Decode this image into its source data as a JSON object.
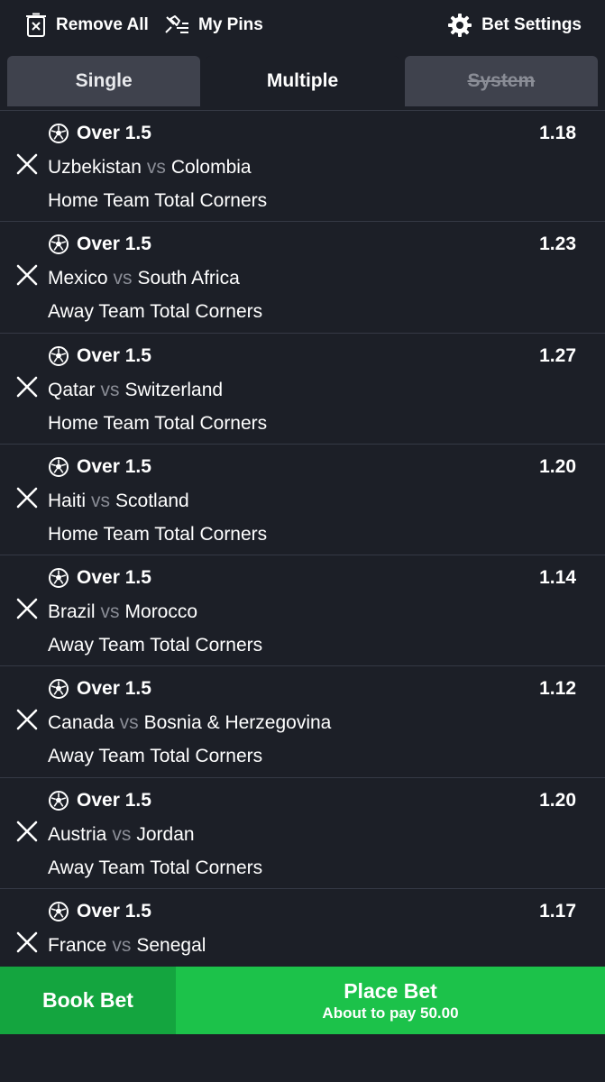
{
  "topbar": {
    "remove_all": "Remove All",
    "my_pins": "My Pins",
    "bet_settings": "Bet Settings"
  },
  "tabs": [
    {
      "label": "Single",
      "state": "inactive"
    },
    {
      "label": "Multiple",
      "state": "active"
    },
    {
      "label": "System",
      "state": "disabled"
    }
  ],
  "vs_label": "vs",
  "selections": [
    {
      "pick": "Over 1.5",
      "odds": "1.18",
      "home": "Uzbekistan",
      "away": "Colombia",
      "market": "Home Team Total Corners"
    },
    {
      "pick": "Over 1.5",
      "odds": "1.23",
      "home": "Mexico",
      "away": "South Africa",
      "market": "Away Team Total Corners"
    },
    {
      "pick": "Over 1.5",
      "odds": "1.27",
      "home": "Qatar",
      "away": "Switzerland",
      "market": "Home Team Total Corners"
    },
    {
      "pick": "Over 1.5",
      "odds": "1.20",
      "home": "Haiti",
      "away": "Scotland",
      "market": "Home Team Total Corners"
    },
    {
      "pick": "Over 1.5",
      "odds": "1.14",
      "home": "Brazil",
      "away": "Morocco",
      "market": "Away Team Total Corners"
    },
    {
      "pick": "Over 1.5",
      "odds": "1.12",
      "home": "Canada",
      "away": "Bosnia & Herzegovina",
      "market": "Away Team Total Corners"
    },
    {
      "pick": "Over 1.5",
      "odds": "1.20",
      "home": "Austria",
      "away": "Jordan",
      "market": "Away Team Total Corners"
    },
    {
      "pick": "Over 1.5",
      "odds": "1.17",
      "home": "France",
      "away": "Senegal",
      "market": ""
    }
  ],
  "footer": {
    "book_bet": "Book Bet",
    "place_bet": "Place Bet",
    "pay_text": "About to pay 50.00"
  },
  "icons": {
    "remove_all": "trash-x-icon",
    "my_pins": "pin-list-icon",
    "settings": "gear-icon",
    "sport": "soccer-ball-icon",
    "remove": "close-icon"
  },
  "colors": {
    "background": "#1c1f27",
    "tab_inactive": "#3f424d",
    "book_bet": "#14a53f",
    "place_bet": "#1cc24a",
    "vs_text": "#8a8d96"
  }
}
